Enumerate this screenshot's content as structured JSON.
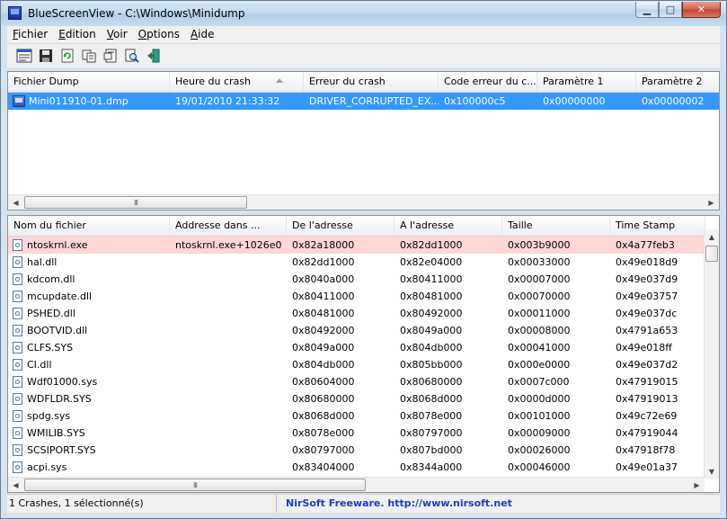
{
  "window": {
    "title": "BlueScreenView  -  C:\\Windows\\Minidump",
    "min_glyph": "▁",
    "max_glyph": "□",
    "close_glyph": "✕"
  },
  "menu": [
    {
      "ul": "F",
      "rest": "ichier"
    },
    {
      "ul": "E",
      "rest": "dition"
    },
    {
      "ul": "V",
      "rest": "oir"
    },
    {
      "ul": "O",
      "rest": "ptions"
    },
    {
      "ul": "A",
      "rest": "ide"
    }
  ],
  "toolbar_icons": [
    "properties-icon",
    "save-icon",
    "refresh-icon",
    "copy-icon",
    "html-report-icon",
    "find-icon",
    "exit-icon"
  ],
  "top_table": {
    "columns": [
      "Fichier Dump",
      "Heure du crash",
      "Erreur du crash",
      "Code erreur du c...",
      "Paramètre 1",
      "Paramètre 2"
    ],
    "rows": [
      [
        "Mini011910-01.dmp",
        "19/01/2010 21:33:32",
        "DRIVER_CORRUPTED_EX...",
        "0x100000c5",
        "0x00000000",
        "0x00000002"
      ]
    ]
  },
  "bottom_table": {
    "columns": [
      "Nom du fichier",
      "Addresse dans ...",
      "De l'adresse",
      "A l'adresse",
      "Taille",
      "Time Stamp"
    ],
    "rows": [
      [
        "ntoskrnl.exe",
        "ntoskrnl.exe+1026e0",
        "0x82a18000",
        "0x82dd1000",
        "0x003b9000",
        "0x4a77feb3"
      ],
      [
        "hal.dll",
        "",
        "0x82dd1000",
        "0x82e04000",
        "0x00033000",
        "0x49e018d9"
      ],
      [
        "kdcom.dll",
        "",
        "0x8040a000",
        "0x80411000",
        "0x00007000",
        "0x49e037d9"
      ],
      [
        "mcupdate.dll",
        "",
        "0x80411000",
        "0x80481000",
        "0x00070000",
        "0x49e03757"
      ],
      [
        "PSHED.dll",
        "",
        "0x80481000",
        "0x80492000",
        "0x00011000",
        "0x49e037dc"
      ],
      [
        "BOOTVID.dll",
        "",
        "0x80492000",
        "0x8049a000",
        "0x00008000",
        "0x4791a653"
      ],
      [
        "CLFS.SYS",
        "",
        "0x8049a000",
        "0x804db000",
        "0x00041000",
        "0x49e018ff"
      ],
      [
        "CI.dll",
        "",
        "0x804db000",
        "0x805bb000",
        "0x000e0000",
        "0x49e037d2"
      ],
      [
        "Wdf01000.sys",
        "",
        "0x80604000",
        "0x80680000",
        "0x0007c000",
        "0x47919015"
      ],
      [
        "WDFLDR.SYS",
        "",
        "0x80680000",
        "0x8068d000",
        "0x0000d000",
        "0x47919013"
      ],
      [
        "spdg.sys",
        "",
        "0x8068d000",
        "0x8078e000",
        "0x00101000",
        "0x49c72e69"
      ],
      [
        "WMILIB.SYS",
        "",
        "0x8078e000",
        "0x80797000",
        "0x00009000",
        "0x47919044"
      ],
      [
        "SCSIPORT.SYS",
        "",
        "0x80797000",
        "0x807bd000",
        "0x00026000",
        "0x47918f78"
      ],
      [
        "acpi.sys",
        "",
        "0x83404000",
        "0x8344a000",
        "0x00046000",
        "0x49e01a37"
      ]
    ]
  },
  "status": {
    "left": "1 Crashes, 1 sélectionné(s)",
    "link": "NirSoft Freeware.  http://www.nirsoft.net"
  }
}
